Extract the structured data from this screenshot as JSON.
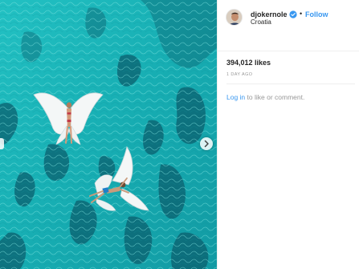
{
  "post": {
    "username": "djokernole",
    "follow_label": "Follow",
    "separator": "•",
    "location": "Croatia",
    "likes": "394,012 likes",
    "time_ago": "1 DAY AGO",
    "login_link": "Log in",
    "login_rest": " to like or comment."
  },
  "colors": {
    "water": "#1fb5b8",
    "follow_blue": "#3897f0",
    "text": "#262626",
    "muted": "#999999"
  },
  "icons": {
    "verified": "verified-badge-icon",
    "next": "chevron-right-icon"
  }
}
